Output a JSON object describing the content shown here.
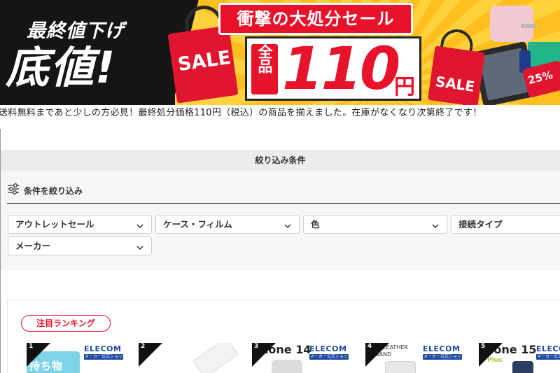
{
  "banner": {
    "subtitle": "最終値下げ",
    "title": "底値!",
    "headline": "衝撃の大処分セール",
    "all_items": "全品",
    "price": "110",
    "yen": "円",
    "sale_tag_left": "SALE",
    "sale_tag_right": "SALE",
    "percent_tag": "25%"
  },
  "notice": "送料無料まであと少しの方必見！最終処分価格110円（税込）の商品を揃えました。在庫がなくなり次第終了です！",
  "filters": {
    "header": "絞り込み条件",
    "title": "条件を絞り込み",
    "selects": [
      {
        "label": "アウトレットセール"
      },
      {
        "label": "ケース・フィルム"
      },
      {
        "label": "色"
      },
      {
        "label": "接続タイプ"
      },
      {
        "label": "メーカー"
      }
    ]
  },
  "ranking": {
    "label": "注目ランキング",
    "items": [
      {
        "rank": "1",
        "brand": "ELECOM",
        "brand_sub": "メーカー公式ショップ",
        "art_text": "持ち物"
      },
      {
        "rank": "2"
      },
      {
        "rank": "3",
        "brand": "ELECOM",
        "brand_sub": "メーカー公式ショップ",
        "art_text": "hone 14"
      },
      {
        "rank": "4",
        "brand": "ELECOM",
        "brand_sub": "メーカー公式ショップ",
        "art_text": "ID LEATHER BAND"
      },
      {
        "rank": "5",
        "brand": "ELECOM",
        "brand_sub": "メーカー公式ショップ",
        "art_text": "hone 15",
        "art_sub": "Plus"
      },
      {
        "brand": "ELECOM"
      }
    ]
  },
  "colors": {
    "accent_red": "#e8122b",
    "brand_blue": "#1f4aa0",
    "banner_yellow": "#ffc628"
  }
}
